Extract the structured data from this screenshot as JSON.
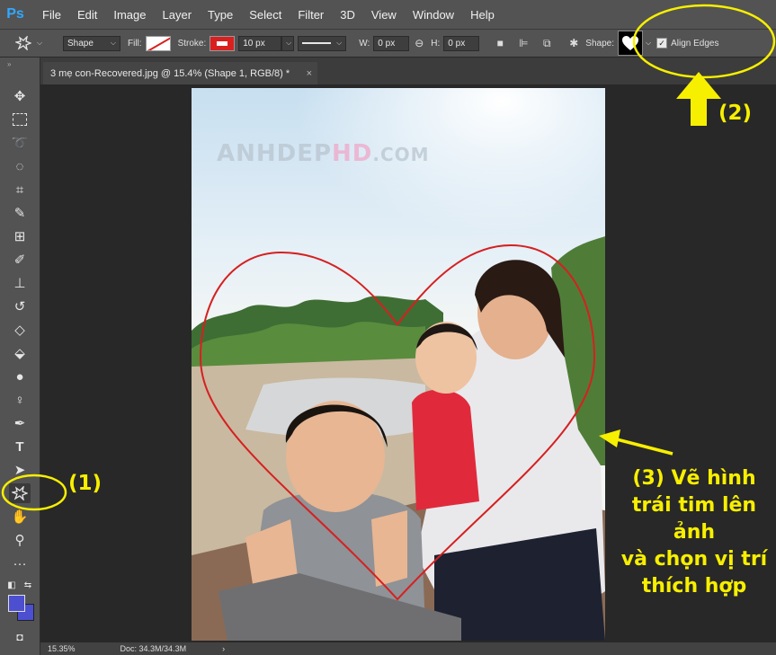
{
  "app": {
    "logo": "Ps"
  },
  "menu": [
    "File",
    "Edit",
    "Image",
    "Layer",
    "Type",
    "Select",
    "Filter",
    "3D",
    "View",
    "Window",
    "Help"
  ],
  "options": {
    "mode": "Shape",
    "fill_label": "Fill:",
    "stroke_label": "Stroke:",
    "stroke_width": "10 px",
    "w_label": "W:",
    "w_value": "0 px",
    "h_label": "H:",
    "h_value": "0 px",
    "shape_label": "Shape:",
    "align_edges": "Align Edges"
  },
  "document_tab": {
    "title": "3 mẹ con-Recovered.jpg @ 15.4% (Shape 1, RGB/8) *",
    "close": "×"
  },
  "status": {
    "zoom": "15.35%",
    "doc": "Doc: 34.3M/34.3M",
    "arrow": "›"
  },
  "watermark": {
    "part1": "ANHDEP",
    "part2": "HD",
    "part3": ".COM"
  },
  "annotations": {
    "one": "(1)",
    "two": "(2)",
    "three_lines": [
      "(3) Vẽ hình",
      "trái tim lên",
      "ảnh",
      "và chọn vị trí",
      "thích hợp"
    ]
  },
  "colors": {
    "accent_annotation": "#f7ef00",
    "heart_stroke": "#d62020",
    "foreground": "#4b4fd0"
  },
  "icons": [
    "move-icon",
    "marquee-icon",
    "lasso-icon",
    "quick-select-icon",
    "crop-icon",
    "eyedropper-icon",
    "healing-icon",
    "brush-icon",
    "stamp-icon",
    "history-brush-icon",
    "eraser-icon",
    "paint-bucket-icon",
    "blur-icon",
    "dodge-icon",
    "pen-icon",
    "type-icon",
    "path-select-icon",
    "custom-shape-icon",
    "hand-icon",
    "zoom-icon",
    "more-icon"
  ]
}
